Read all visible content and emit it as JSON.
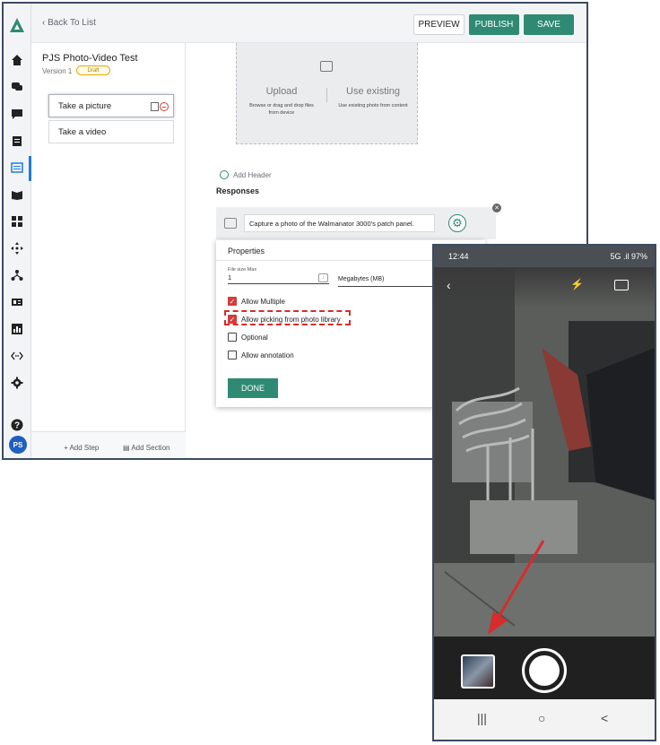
{
  "topbar": {
    "back_label": "Back To List",
    "preview_label": "PREVIEW",
    "publish_label": "PUBLISH",
    "save_label": "SAVE"
  },
  "procedure": {
    "title": "PJS Photo-Video Test",
    "version": "Version 1",
    "status_badge": "Draft"
  },
  "steps": [
    {
      "label": "Take a picture",
      "selected": true
    },
    {
      "label": "Take a video",
      "selected": false
    }
  ],
  "left_footer": {
    "add_step_label": "Add Step",
    "add_section_label": "Add Section"
  },
  "dropzone": {
    "upload_title": "Upload",
    "upload_sub": "Browse or drag and drop files from device",
    "existing_title": "Use existing",
    "existing_sub": "Use existing photo from content"
  },
  "add_header_label": "Add Header",
  "responses_label": "Responses",
  "response_text": "Capture a photo of the Walmanator 3000's patch panel.",
  "properties": {
    "title": "Properties",
    "file_size_label": "File size Max",
    "file_size_value": "1",
    "unit_value": "Megabytes (MB)",
    "options": [
      {
        "label": "Allow Multiple",
        "checked": true
      },
      {
        "label": "Allow picking from photo library",
        "checked": true,
        "highlighted": true
      },
      {
        "label": "Optional",
        "checked": false
      },
      {
        "label": "Allow annotation",
        "checked": false
      }
    ],
    "done_label": "DONE"
  },
  "avatar_initials": "PS",
  "phone": {
    "time": "12:44",
    "status_right": "5G .il 97%",
    "nav_buttons": [
      "|||",
      "○",
      "<"
    ]
  },
  "colors": {
    "accent": "#2f8a73",
    "highlight": "#d62c2c",
    "nav_active": "#1f7ae0"
  }
}
